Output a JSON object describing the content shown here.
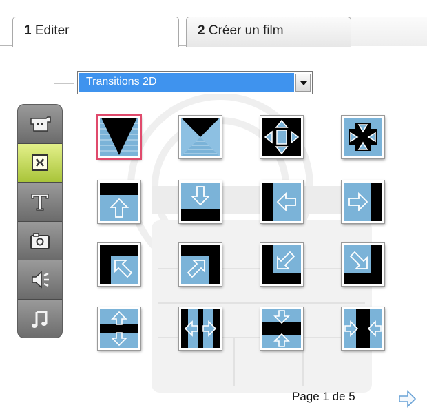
{
  "tabs": [
    {
      "number": "1",
      "label": "Editer",
      "active": true
    },
    {
      "number": "2",
      "label": "Créer un film",
      "active": false
    }
  ],
  "dropdown": {
    "selected": "Transitions 2D"
  },
  "toolbar": {
    "items": [
      {
        "icon": "video-clip-icon",
        "active": false
      },
      {
        "icon": "transition-icon",
        "active": true
      },
      {
        "icon": "title-text-icon",
        "active": false
      },
      {
        "icon": "photo-icon",
        "active": false
      },
      {
        "icon": "audio-speaker-icon",
        "active": false
      },
      {
        "icon": "music-note-icon",
        "active": false
      }
    ]
  },
  "transitions": [
    {
      "icon": "wipe-down-triangle-icon",
      "selected": true
    },
    {
      "icon": "hourglass-wipe-icon",
      "selected": false
    },
    {
      "icon": "expand-arrows-out-icon",
      "selected": false
    },
    {
      "icon": "contract-arrows-in-icon",
      "selected": false
    },
    {
      "icon": "push-up-icon",
      "selected": false
    },
    {
      "icon": "push-down-icon",
      "selected": false
    },
    {
      "icon": "push-left-icon",
      "selected": false
    },
    {
      "icon": "push-right-icon",
      "selected": false
    },
    {
      "icon": "push-up-left-icon",
      "selected": false
    },
    {
      "icon": "push-up-right-icon",
      "selected": false
    },
    {
      "icon": "push-down-left-icon",
      "selected": false
    },
    {
      "icon": "push-down-right-icon",
      "selected": false
    },
    {
      "icon": "split-vertical-open-icon",
      "selected": false
    },
    {
      "icon": "split-horizontal-open-icon",
      "selected": false
    },
    {
      "icon": "split-vertical-close-icon",
      "selected": false
    },
    {
      "icon": "split-horizontal-close-icon",
      "selected": false
    }
  ],
  "pagination": {
    "label": "Page 1 de 5"
  },
  "colors": {
    "accent": "#3f93ee",
    "tile_blue": "#7bb3d8",
    "active_tool": "#c3d95a",
    "selection": "#e04a6c"
  }
}
